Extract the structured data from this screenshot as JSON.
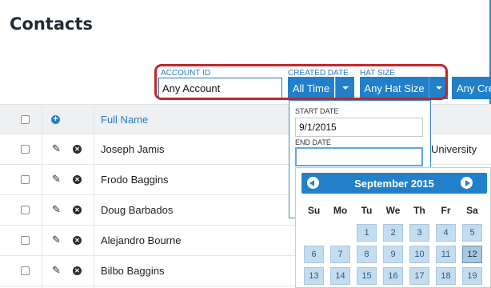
{
  "page": {
    "title": "Contacts"
  },
  "filters": {
    "account": {
      "label": "ACCOUNT ID",
      "value": "Any Account"
    },
    "created": {
      "label": "CREATED DATE",
      "button": "All Time"
    },
    "hat": {
      "label": "HAT SIZE",
      "button": "Any Hat Size"
    },
    "extra": {
      "button": "Any Cre"
    }
  },
  "table": {
    "header": {
      "full_name": "Full Name"
    },
    "rows": [
      {
        "name": "Joseph Jamis",
        "extra": "University"
      },
      {
        "name": "Frodo Baggins"
      },
      {
        "name": "Doug Barbados"
      },
      {
        "name": "Alejandro Bourne"
      },
      {
        "name": "Bilbo Baggins"
      }
    ]
  },
  "date_dropdown": {
    "start_label": "START DATE",
    "start_value": "9/1/2015",
    "end_label": "END DATE",
    "end_value": ""
  },
  "calendar": {
    "month": "September 2015",
    "weekdays": [
      "Su",
      "Mo",
      "Tu",
      "We",
      "Th",
      "Fr",
      "Sa"
    ],
    "week1": [
      "1",
      "2",
      "3",
      "4",
      "5"
    ],
    "week2": [
      "6",
      "7",
      "8",
      "9",
      "10",
      "11",
      "12"
    ],
    "week3": [
      "13",
      "14",
      "15",
      "16",
      "17",
      "18",
      "19"
    ],
    "selected_day": "12"
  },
  "colors": {
    "accent": "#2180c9",
    "highlight": "#c0272d"
  }
}
